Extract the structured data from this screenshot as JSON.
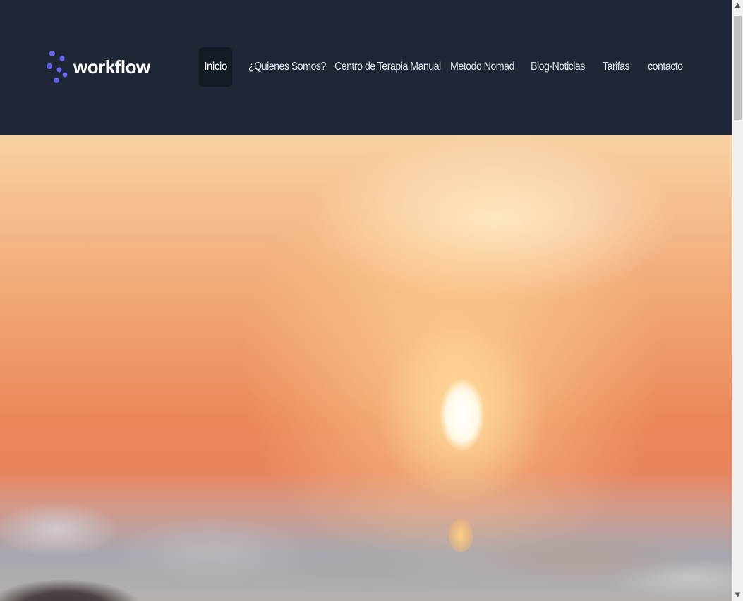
{
  "brand": {
    "name": "workflow",
    "logo_icon": "dots-logo-icon",
    "color": "#6366f1"
  },
  "nav": {
    "items": [
      {
        "label": "Inicio",
        "active": true
      },
      {
        "label": "¿Quienes Somos?",
        "active": false
      },
      {
        "label": "Centro de Terapia Manual",
        "active": false
      },
      {
        "label": "Metodo Nomad",
        "active": false
      },
      {
        "label": "Blog-Noticias",
        "active": false
      },
      {
        "label": "Tarifas",
        "active": false
      },
      {
        "label": "contacto",
        "active": false
      }
    ]
  },
  "hero": {
    "image": "blurred-sunset-over-sea"
  },
  "colors": {
    "navbar_bg": "#1f2737",
    "active_item_bg": "#121a26",
    "nav_text": "#dfe3ea"
  },
  "scrollbar": {
    "up_icon": "chevron-up-icon",
    "down_icon": "chevron-down-icon"
  }
}
